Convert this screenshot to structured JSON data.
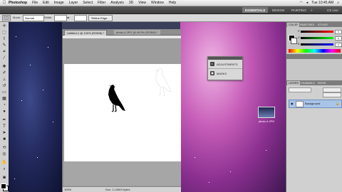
{
  "menubar": {
    "app": "Photoshop",
    "items": [
      "File",
      "Edit",
      "Image",
      "Layer",
      "Select",
      "Filter",
      "Analysis",
      "3D",
      "View",
      "Window",
      "Help"
    ],
    "clock": "Tue 10:45 AM"
  },
  "appbar": {
    "essentials": "ESSENTIALS",
    "design": "DESIGN",
    "painting": "PAINTING",
    "more": "»",
    "cs_live": "CS Live"
  },
  "options": {
    "mode_label": "Mode:",
    "mode_value": "Normal",
    "width_label": "Width:",
    "refine": "Refine Edge..."
  },
  "document": {
    "tab1": "Untitled-1 @ 100% (RGB/8) *",
    "tab2": "photo-4.JPG @ 49.9% (RGB/8) *",
    "zoom": "100%",
    "doc_info": "Doc: 1.14M/0 bytes"
  },
  "adjustments_panel": {
    "adjustments": "ADJUSTMENTS",
    "masks": "MASKS"
  },
  "desktop_file": {
    "label": "photo-4.JPG"
  },
  "dock": {
    "color_tabs": [
      "COLOR",
      "SWATCHES",
      "STYLES"
    ],
    "slider_labels": [
      "R",
      "G",
      "B"
    ],
    "slider_values": [
      "0",
      "0",
      "0"
    ],
    "layer_tabs": [
      "LAYERS",
      "CHANNELS",
      "PATHS"
    ],
    "layer_name": "Background"
  },
  "colors": {
    "menubar": "#e4e4e4",
    "layer_selected": "#a9c4e8",
    "desktop_purple": "#c65db8"
  }
}
